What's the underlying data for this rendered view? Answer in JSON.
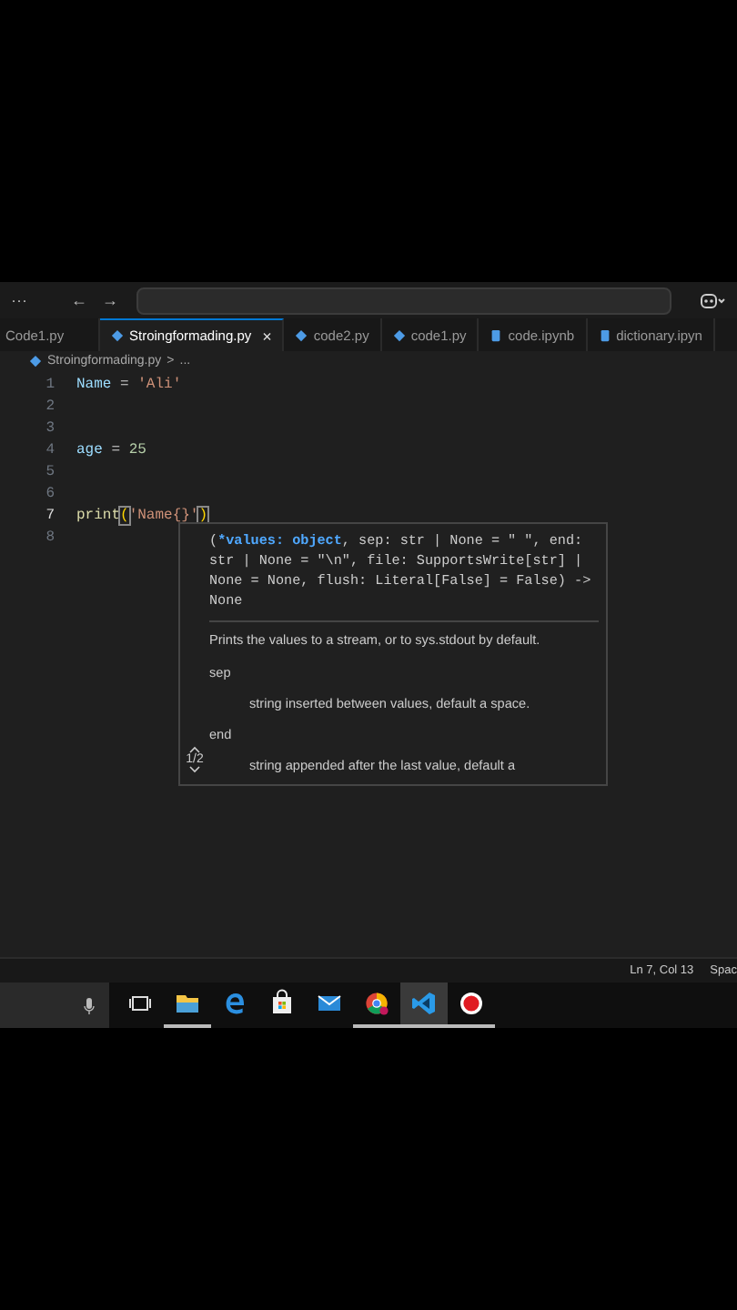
{
  "title_bar": {
    "menu": "···",
    "back": "←",
    "forward": "→"
  },
  "tabs": [
    {
      "label": "Code1.py",
      "kind": "plain",
      "selected": false
    },
    {
      "label": "Stroingformading.py",
      "kind": "python",
      "selected": true,
      "close": "×"
    },
    {
      "label": "code2.py",
      "kind": "python",
      "selected": false
    },
    {
      "label": "code1.py",
      "kind": "python",
      "selected": false
    },
    {
      "label": "code.ipynb",
      "kind": "notebook",
      "selected": false
    },
    {
      "label": "dictionary.ipyn",
      "kind": "notebook",
      "selected": false
    }
  ],
  "breadcrumb": {
    "file": "Stroingformading.py",
    "separator": ">",
    "rest": "..."
  },
  "editor": {
    "lines": [
      {
        "number": "1",
        "active": false,
        "tokens": [
          {
            "text": "Name",
            "kind": "var"
          },
          {
            "text": " = ",
            "kind": "op"
          },
          {
            "text": "'Ali'",
            "kind": "string"
          }
        ]
      },
      {
        "number": "2",
        "active": false
      },
      {
        "number": "3",
        "active": false
      },
      {
        "number": "4",
        "active": false,
        "tokens": [
          {
            "text": "age",
            "kind": "var"
          },
          {
            "text": " = ",
            "kind": "op"
          },
          {
            "text": "25",
            "kind": "number"
          }
        ]
      },
      {
        "number": "5",
        "active": false
      },
      {
        "number": "6",
        "active": false
      },
      {
        "number": "7",
        "active": true,
        "tokens": [
          {
            "text": "print",
            "kind": "func"
          },
          {
            "text": "(",
            "kind": "bracket"
          },
          {
            "text": "'Name{}'",
            "kind": "string"
          },
          {
            "text": ")",
            "kind": "bracket"
          }
        ]
      },
      {
        "number": "8",
        "active": false
      }
    ]
  },
  "hover": {
    "signature_open": "(",
    "active_parameter": "*values: object",
    "signature_rest": ", sep: str | None = \" \", end: str | None = \"\\n\", file: SupportsWrite[str] | None = None, flush: Literal[False] = False) -> None",
    "description": "Prints the values to a stream, or to sys.stdout by default.",
    "params": [
      {
        "name": "sep",
        "doc": "string inserted between values, default a space."
      },
      {
        "name": "end",
        "doc": "string appended after the last value, default a"
      }
    ],
    "overload": "1/2"
  },
  "status_bar": {
    "position": "Ln 7, Col 13",
    "indent": "Spac"
  },
  "taskbar": {
    "items": [
      {
        "kind": "taskview",
        "running": false,
        "selected": false
      },
      {
        "kind": "explorer",
        "running": true,
        "selected": false
      },
      {
        "kind": "edge",
        "running": false,
        "selected": false
      },
      {
        "kind": "store",
        "running": false,
        "selected": false
      },
      {
        "kind": "mail",
        "running": false,
        "selected": false
      },
      {
        "kind": "chrome",
        "running": true,
        "selected": false
      },
      {
        "kind": "vscode",
        "running": true,
        "selected": true
      },
      {
        "kind": "record",
        "running": true,
        "selected": false
      }
    ]
  }
}
